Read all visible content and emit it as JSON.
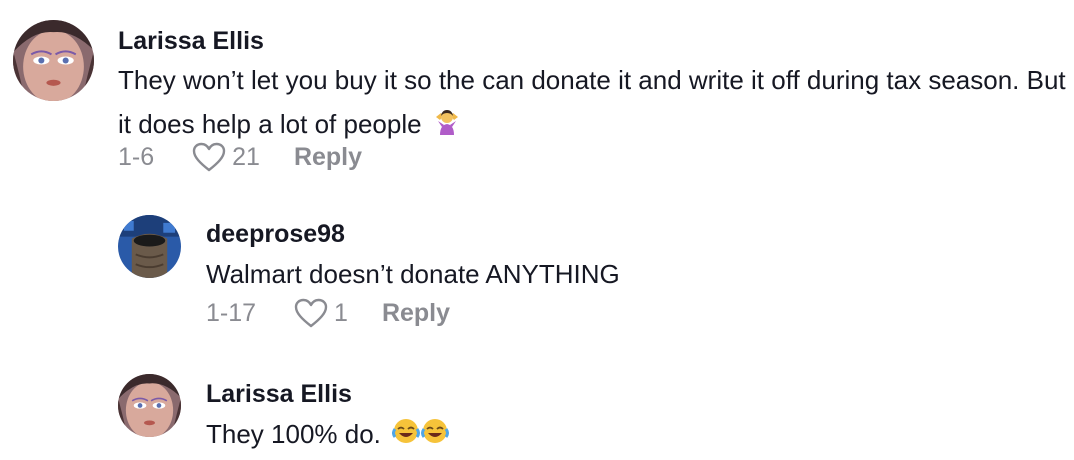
{
  "comments": [
    {
      "author": "Larissa Ellis",
      "text": "They won’t let you buy it so the can donate it and write it off during tax season. But it does help a lot of people",
      "date": "1-6",
      "likes": "21",
      "reply_label": "Reply",
      "avatar_icon": "profile-photo",
      "emoji_icon": "person-shrugging-emoji"
    },
    {
      "author": "deeprose98",
      "text": "Walmart doesn’t donate ANYTHING",
      "date": "1-17",
      "likes": "1",
      "reply_label": "Reply",
      "avatar_icon": "profile-photo"
    },
    {
      "author": "Larissa Ellis",
      "text": "They 100% do.",
      "avatar_icon": "profile-photo",
      "emoji_icon": "tears-of-joy-emoji"
    }
  ],
  "colors": {
    "primary_text": "#161823",
    "secondary_text": "#8a8b91"
  }
}
